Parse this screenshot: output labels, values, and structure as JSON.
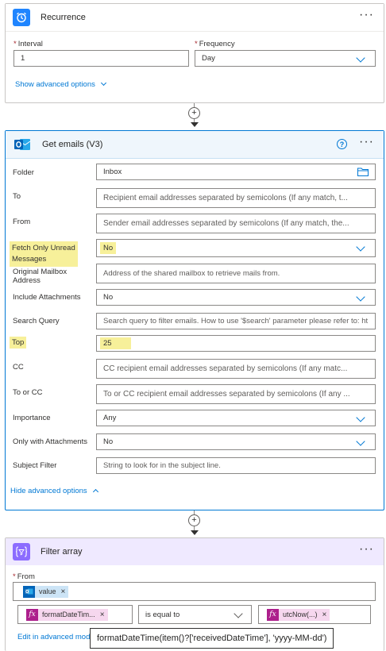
{
  "recurrence": {
    "title": "Recurrence",
    "interval_label": "Interval",
    "interval_value": "1",
    "frequency_label": "Frequency",
    "frequency_value": "Day",
    "advanced_link": "Show advanced options",
    "icon": "alarm-clock-icon",
    "accent": "#1f85ff"
  },
  "connector_symbol": "+",
  "get_emails": {
    "title": "Get emails (V3)",
    "icon": "outlook-icon",
    "accent": "#0364b8",
    "fields": {
      "folder_label": "Folder",
      "folder_value": "Inbox",
      "to_label": "To",
      "to_placeholder": "Recipient email addresses separated by semicolons (If any match, t...",
      "from_label": "From",
      "from_placeholder": "Sender email addresses separated by semicolons (If any match, the...",
      "fetch_unread_label": "Fetch Only Unread Messages",
      "fetch_unread_value": "No",
      "original_mailbox_label": "Original Mailbox Address",
      "original_mailbox_placeholder": "Address of the shared mailbox to retrieve mails from.",
      "include_attachments_label": "Include Attachments",
      "include_attachments_value": "No",
      "search_query_label": "Search Query",
      "search_query_placeholder": "Search query to filter emails. How to use '$search' parameter please refer to: ht",
      "top_label": "Top",
      "top_value": "25",
      "cc_label": "CC",
      "cc_placeholder": "CC recipient email addresses separated by semicolons (If any matc...",
      "to_or_cc_label": "To or CC",
      "to_or_cc_placeholder": "To or CC recipient email addresses separated by semicolons (If any ...",
      "importance_label": "Importance",
      "importance_value": "Any",
      "only_with_attachments_label": "Only with Attachments",
      "only_with_attachments_value": "No",
      "subject_filter_label": "Subject Filter",
      "subject_filter_placeholder": "String to look for in the subject line."
    },
    "hide_advanced_link": "Hide advanced options"
  },
  "filter_array": {
    "title": "Filter array",
    "icon": "filter-braces-icon",
    "accent": "#8c6cff",
    "from_label": "From",
    "from_token": "value",
    "left_token": "formatDateTim...",
    "operator": "is equal to",
    "right_token": "utcNow(...)",
    "edit_advanced_link": "Edit in advanced mode",
    "tooltip": "formatDateTime(item()?['receivedDateTime'], 'yyyy-MM-dd')"
  }
}
